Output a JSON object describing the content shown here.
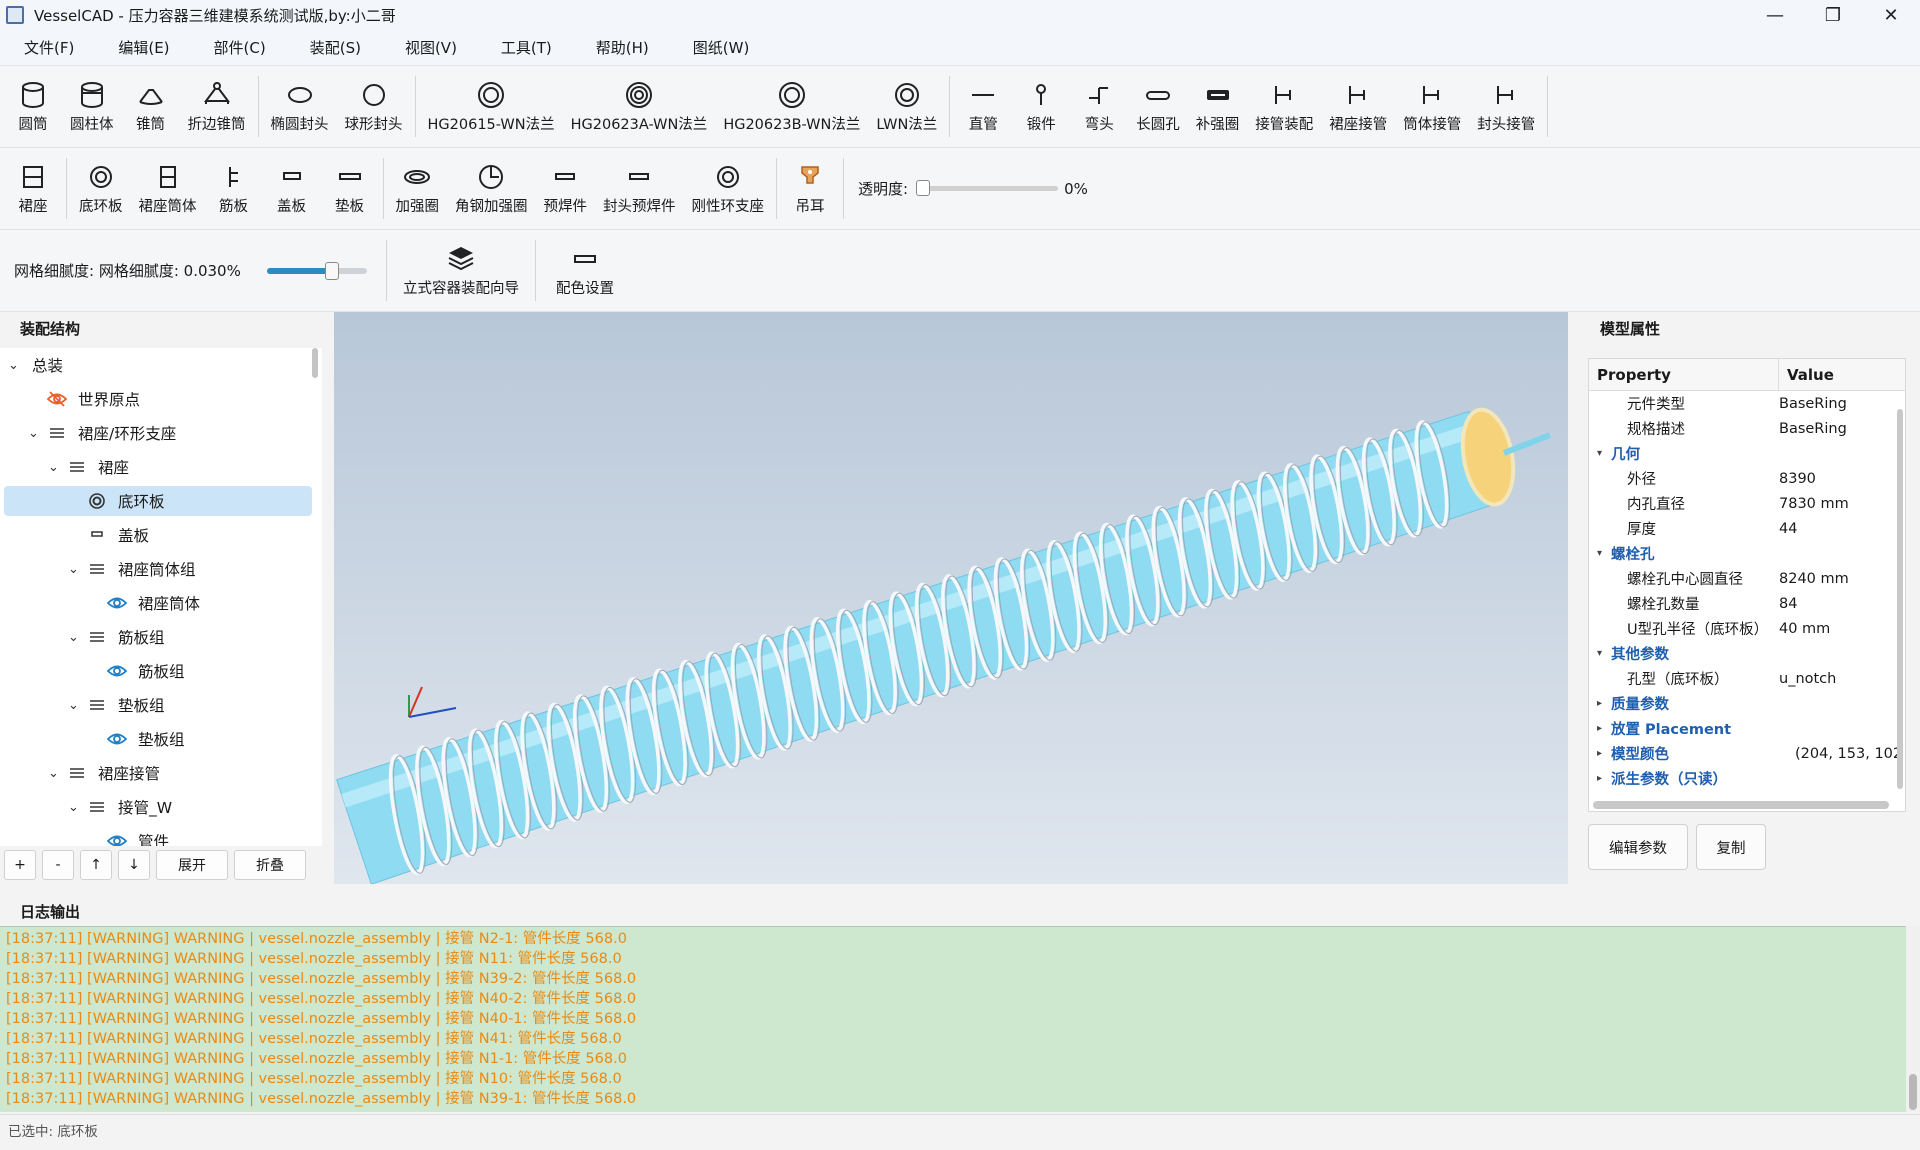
{
  "window": {
    "title": "VesselCAD - 压力容器三维建模系统测试版,by:小二哥",
    "min": "—",
    "max": "❐",
    "close": "✕"
  },
  "menu": [
    "文件(F)",
    "编辑(E)",
    "部件(C)",
    "装配(S)",
    "视图(V)",
    "工具(T)",
    "帮助(H)",
    "图纸(W)"
  ],
  "toolbar1": [
    {
      "label": "圆筒",
      "icon": "cylinder-icon"
    },
    {
      "label": "圆柱体",
      "icon": "cylinder-solid-icon"
    },
    {
      "label": "锥筒",
      "icon": "cone-icon"
    },
    {
      "label": "折边锥筒",
      "icon": "folded-cone-icon"
    },
    {
      "label": "椭圆封头",
      "icon": "ellipse-head-icon"
    },
    {
      "label": "球形封头",
      "icon": "sphere-head-icon"
    },
    {
      "label": "HG20615-WN法兰",
      "icon": "flange-icon"
    },
    {
      "label": "HG20623A-WN法兰",
      "icon": "flange-icon"
    },
    {
      "label": "HG20623B-WN法兰",
      "icon": "flange-icon"
    },
    {
      "label": "LWN法兰",
      "icon": "flange-icon"
    },
    {
      "label": "直管",
      "icon": "pipe-icon"
    },
    {
      "label": "锻件",
      "icon": "forging-icon"
    },
    {
      "label": "弯头",
      "icon": "elbow-icon"
    },
    {
      "label": "长圆孔",
      "icon": "slot-icon"
    },
    {
      "label": "补强圈",
      "icon": "reinforce-icon"
    },
    {
      "label": "接管装配",
      "icon": "nozzle-icon"
    },
    {
      "label": "裙座接管",
      "icon": "nozzle-icon"
    },
    {
      "label": "筒体接管",
      "icon": "nozzle-icon"
    },
    {
      "label": "封头接管",
      "icon": "nozzle-icon"
    }
  ],
  "toolbar2": [
    {
      "label": "裙座",
      "icon": "skirt-icon"
    },
    {
      "label": "底环板",
      "icon": "ring-icon"
    },
    {
      "label": "裙座筒体",
      "icon": "skirt-shell-icon"
    },
    {
      "label": "筋板",
      "icon": "rib-icon"
    },
    {
      "label": "盖板",
      "icon": "cover-plate-icon"
    },
    {
      "label": "垫板",
      "icon": "pad-icon"
    },
    {
      "label": "加强圈",
      "icon": "stiffener-ring-icon"
    },
    {
      "label": "角钢加强圈",
      "icon": "angle-ring-icon"
    },
    {
      "label": "预焊件",
      "icon": "weld-icon"
    },
    {
      "label": "封头预焊件",
      "icon": "weld-icon"
    },
    {
      "label": "刚性环支座",
      "icon": "ring-support-icon"
    },
    {
      "label": "吊耳",
      "icon": "lifting-lug-icon"
    }
  ],
  "transparency": {
    "label": "透明度:",
    "value": "0%"
  },
  "mesh": {
    "label": "网格细腻度: 网格细腻度: 0.030%"
  },
  "toolbar3": [
    {
      "label": "立式容器装配向导",
      "icon": "layers-icon"
    },
    {
      "label": "配色设置",
      "icon": "color-icon"
    }
  ],
  "assembly": {
    "title": "装配结构",
    "tree": [
      {
        "label": "总装",
        "level": 0,
        "chev": "⌄",
        "icon": "none"
      },
      {
        "label": "世界原点",
        "level": 1,
        "chev": "",
        "icon": "hidden-icon"
      },
      {
        "label": "裙座/环形支座",
        "level": 1,
        "chev": "⌄",
        "icon": "list-icon"
      },
      {
        "label": "裙座",
        "level": 2,
        "chev": "⌄",
        "icon": "list-icon"
      },
      {
        "label": "底环板",
        "level": 3,
        "chev": "",
        "icon": "ring-icon",
        "selected": true
      },
      {
        "label": "盖板",
        "level": 3,
        "chev": "",
        "icon": "plate-icon"
      },
      {
        "label": "裙座筒体组",
        "level": 3,
        "chev": "⌄",
        "icon": "list-icon"
      },
      {
        "label": "裙座筒体",
        "level": 4,
        "chev": "",
        "icon": "eye-icon"
      },
      {
        "label": "筋板组",
        "level": 3,
        "chev": "⌄",
        "icon": "list-icon"
      },
      {
        "label": "筋板组",
        "level": 4,
        "chev": "",
        "icon": "eye-icon"
      },
      {
        "label": "垫板组",
        "level": 3,
        "chev": "⌄",
        "icon": "list-icon"
      },
      {
        "label": "垫板组",
        "level": 4,
        "chev": "",
        "icon": "eye-icon"
      },
      {
        "label": "裙座接管",
        "level": 2,
        "chev": "⌄",
        "icon": "list-icon"
      },
      {
        "label": "接管_W",
        "level": 3,
        "chev": "⌄",
        "icon": "list-icon"
      },
      {
        "label": "管件",
        "level": 4,
        "chev": "",
        "icon": "eye-icon"
      }
    ],
    "buttons": [
      "+",
      "-",
      "↑",
      "↓",
      "展开",
      "折叠"
    ]
  },
  "properties": {
    "title": "模型属性",
    "col_property": "Property",
    "col_value": "Value",
    "rows": [
      {
        "key": "元件类型",
        "value": "BaseRing",
        "group": false
      },
      {
        "key": "规格描述",
        "value": "BaseRing",
        "group": false
      },
      {
        "key": "几何",
        "value": "",
        "group": true,
        "open": true
      },
      {
        "key": "外径",
        "value": "8390",
        "group": false
      },
      {
        "key": "内孔直径",
        "value": "7830 mm",
        "group": false
      },
      {
        "key": "厚度",
        "value": "44",
        "group": false
      },
      {
        "key": "螺栓孔",
        "value": "",
        "group": true,
        "open": true
      },
      {
        "key": "螺栓孔中心圆直径",
        "value": "8240 mm",
        "group": false
      },
      {
        "key": "螺栓孔数量",
        "value": "84",
        "group": false
      },
      {
        "key": "U型孔半径（底环板）",
        "value": "40 mm",
        "group": false
      },
      {
        "key": "其他参数",
        "value": "",
        "group": true,
        "open": true
      },
      {
        "key": "孔型（底环板）",
        "value": "u_notch",
        "group": false
      },
      {
        "key": "质量参数",
        "value": "",
        "group": true,
        "open": false
      },
      {
        "key": "放置 Placement",
        "value": "",
        "group": true,
        "open": false
      },
      {
        "key": "模型颜色",
        "value": "(204, 153, 102",
        "group": true,
        "open": false
      },
      {
        "key": "派生参数（只读）",
        "value": "",
        "group": true,
        "open": false
      }
    ],
    "buttons": [
      "编辑参数",
      "复制"
    ]
  },
  "log": {
    "title": "日志输出",
    "lines": [
      "[18:37:11] [WARNING] WARNING | vessel.nozzle_assembly | 接管 N2-1: 管件长度 568.0",
      "[18:37:11] [WARNING] WARNING | vessel.nozzle_assembly | 接管 N11: 管件长度 568.0",
      "[18:37:11] [WARNING] WARNING | vessel.nozzle_assembly | 接管 N39-2: 管件长度 568.0",
      "[18:37:11] [WARNING] WARNING | vessel.nozzle_assembly | 接管 N40-2: 管件长度 568.0",
      "[18:37:11] [WARNING] WARNING | vessel.nozzle_assembly | 接管 N40-1: 管件长度 568.0",
      "[18:37:11] [WARNING] WARNING | vessel.nozzle_assembly | 接管 N41: 管件长度 568.0",
      "[18:37:11] [WARNING] WARNING | vessel.nozzle_assembly | 接管 N1-1: 管件长度 568.0",
      "[18:37:11] [WARNING] WARNING | vessel.nozzle_assembly | 接管 N10: 管件长度 568.0",
      "[18:37:11] [WARNING] WARNING | vessel.nozzle_assembly | 接管 N39-1: 管件长度 568.0"
    ]
  },
  "status": "已选中: 底环板",
  "colors": {
    "vessel": "#8fdcf2",
    "ring": "#f4f8fb",
    "head": "#f6d27a",
    "log_bg": "#cde8cf",
    "log_text": "#e88a15",
    "accent": "#1f5fb0"
  }
}
